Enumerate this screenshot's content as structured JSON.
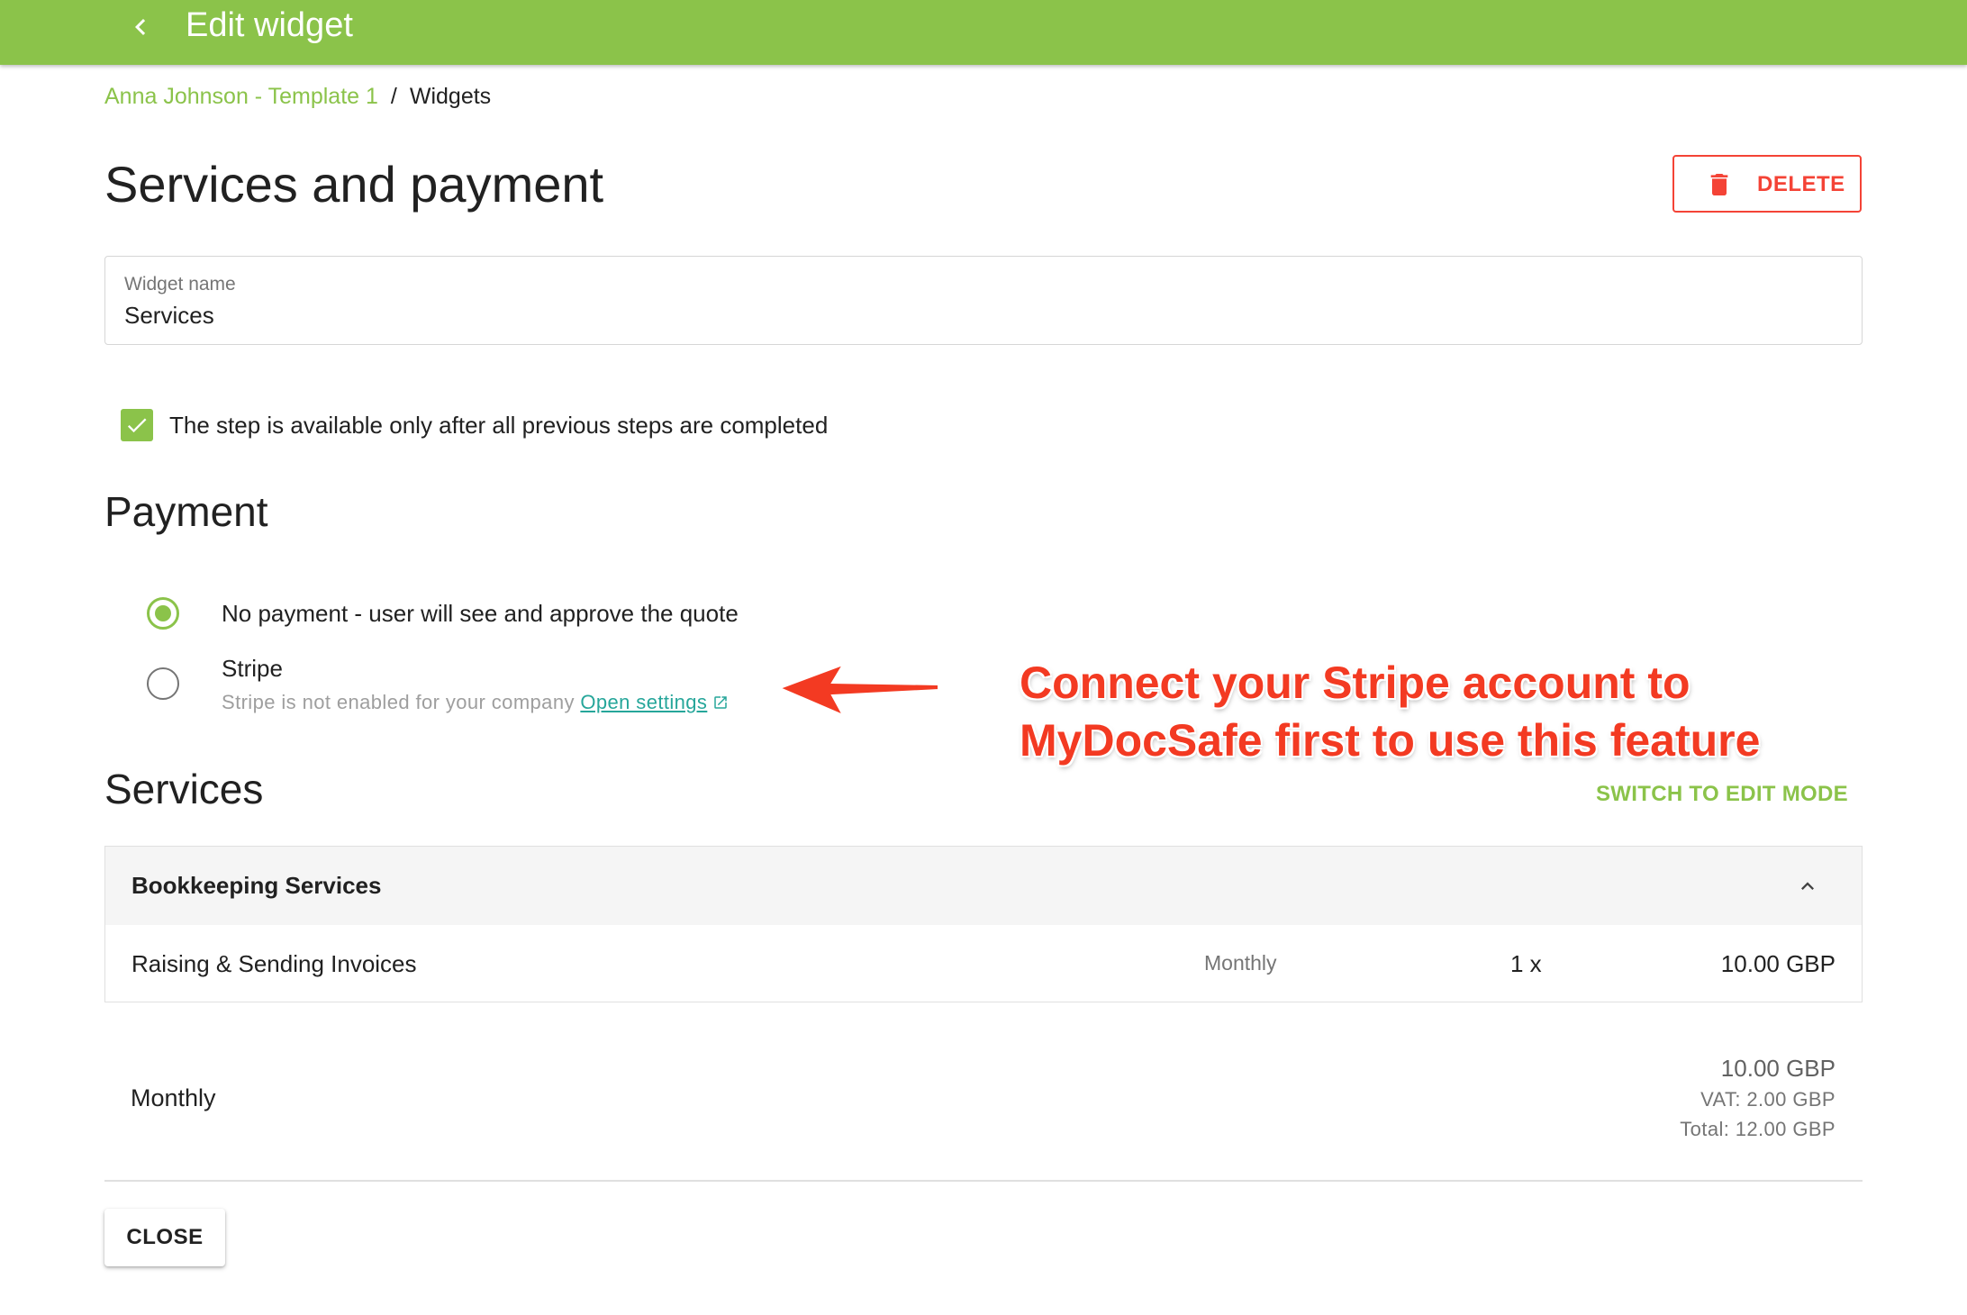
{
  "header": {
    "title": "Edit widget",
    "back_icon": "chevron-left-icon"
  },
  "breadcrumb": {
    "parent": "Anna Johnson - Template 1",
    "separator": "/",
    "current": "Widgets"
  },
  "page": {
    "title": "Services and payment",
    "delete_label": "DELETE"
  },
  "widget_name": {
    "label": "Widget name",
    "value": "Services"
  },
  "step_option": {
    "checked": true,
    "label": "The step is available only after all previous steps are completed"
  },
  "payment": {
    "title": "Payment",
    "options": [
      {
        "label": "No payment - user will see and approve the quote",
        "selected": true
      },
      {
        "label": "Stripe",
        "selected": false,
        "note": "Stripe is not enabled for your company",
        "link": "Open settings"
      }
    ]
  },
  "annotation": {
    "line1": "Connect your Stripe account to",
    "line2": "MyDocSafe first to use this feature"
  },
  "services": {
    "title": "Services",
    "switch_label": "SWITCH TO EDIT MODE",
    "groups": [
      {
        "name": "Bookkeeping Services",
        "expanded": true,
        "items": [
          {
            "name": "Raising & Sending Invoices",
            "period": "Monthly",
            "qty": "1 x",
            "price": "10.00 GBP"
          }
        ]
      }
    ]
  },
  "summary": {
    "period": "Monthly",
    "amount": "10.00 GBP",
    "vat": "VAT: 2.00 GBP",
    "total": "Total: 12.00 GBP"
  },
  "footer": {
    "close_label": "CLOSE"
  },
  "colors": {
    "accent": "#8bc34a",
    "danger": "#f44336",
    "link": "#26a69a",
    "annotation": "#f33a22"
  }
}
